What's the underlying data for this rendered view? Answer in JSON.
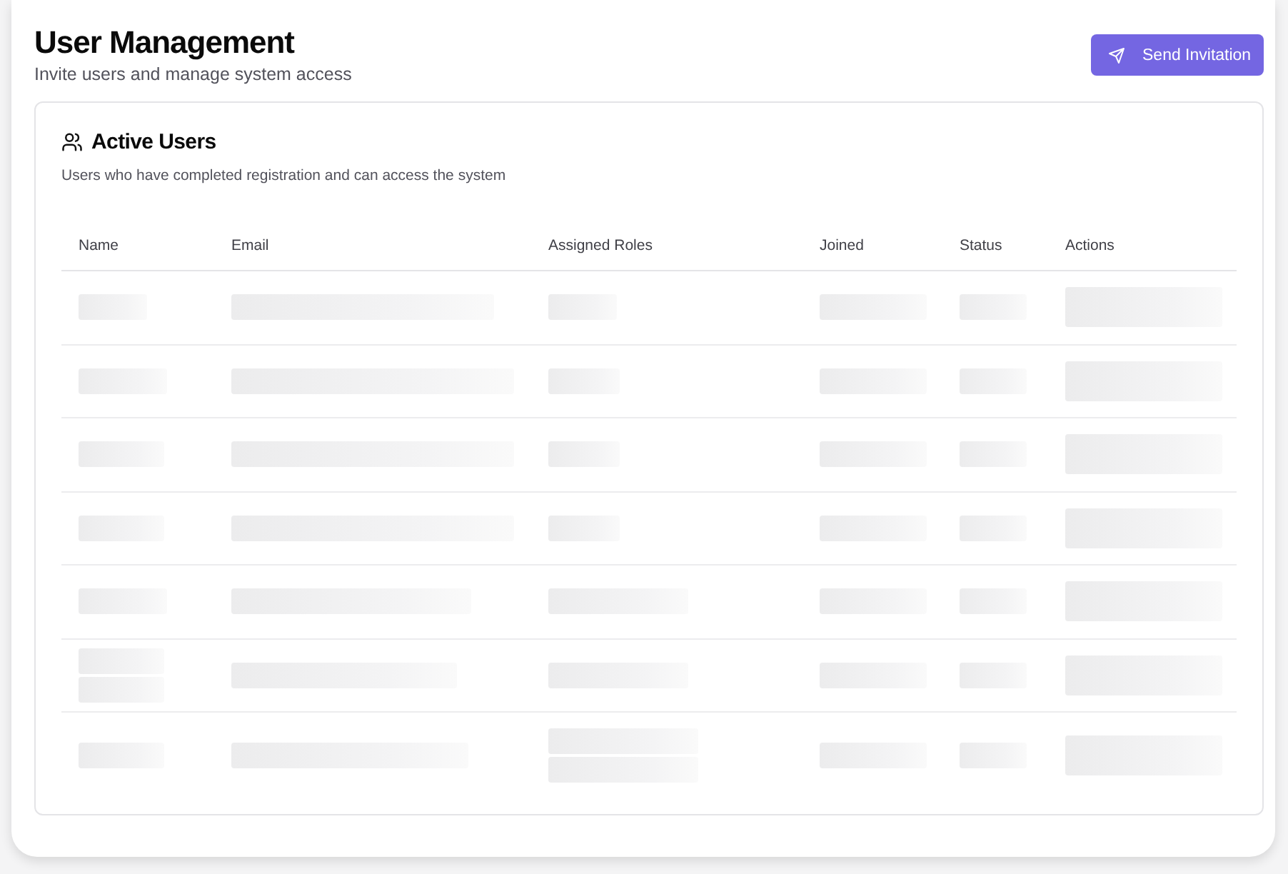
{
  "header": {
    "title": "User Management",
    "subtitle": "Invite users and manage system access",
    "action_button": "Send Invitation"
  },
  "card": {
    "title": "Active Users",
    "description": "Users who have completed registration and can access the system"
  },
  "table": {
    "columns": [
      "Name",
      "Email",
      "Assigned Roles",
      "Joined",
      "Status",
      "Actions"
    ],
    "rows": [
      {
        "kind": "placeholder",
        "cells": [
          {
            "kind": "single"
          },
          {
            "kind": "single"
          },
          {
            "kind": "single"
          },
          {
            "kind": "single"
          },
          {
            "kind": "single"
          },
          {
            "kind": "button"
          }
        ]
      },
      {
        "kind": "placeholder",
        "cells": [
          {
            "kind": "single"
          },
          {
            "kind": "single"
          },
          {
            "kind": "single"
          },
          {
            "kind": "single"
          },
          {
            "kind": "single"
          },
          {
            "kind": "button"
          }
        ]
      },
      {
        "kind": "placeholder",
        "cells": [
          {
            "kind": "single"
          },
          {
            "kind": "single"
          },
          {
            "kind": "single"
          },
          {
            "kind": "single"
          },
          {
            "kind": "single"
          },
          {
            "kind": "button"
          }
        ]
      },
      {
        "kind": "placeholder",
        "cells": [
          {
            "kind": "single"
          },
          {
            "kind": "single"
          },
          {
            "kind": "single"
          },
          {
            "kind": "single"
          },
          {
            "kind": "single"
          },
          {
            "kind": "button"
          }
        ]
      },
      {
        "kind": "placeholder",
        "cells": [
          {
            "kind": "single"
          },
          {
            "kind": "single"
          },
          {
            "kind": "single"
          },
          {
            "kind": "single"
          },
          {
            "kind": "single"
          },
          {
            "kind": "button"
          }
        ]
      },
      {
        "kind": "placeholder",
        "cells": [
          {
            "kind": "double"
          },
          {
            "kind": "single"
          },
          {
            "kind": "single"
          },
          {
            "kind": "single"
          },
          {
            "kind": "single"
          },
          {
            "kind": "button"
          }
        ]
      },
      {
        "kind": "placeholder",
        "cells": [
          {
            "kind": "single"
          },
          {
            "kind": "single"
          },
          {
            "kind": "double"
          },
          {
            "kind": "single"
          },
          {
            "kind": "single"
          },
          {
            "kind": "button"
          }
        ]
      }
    ]
  }
}
